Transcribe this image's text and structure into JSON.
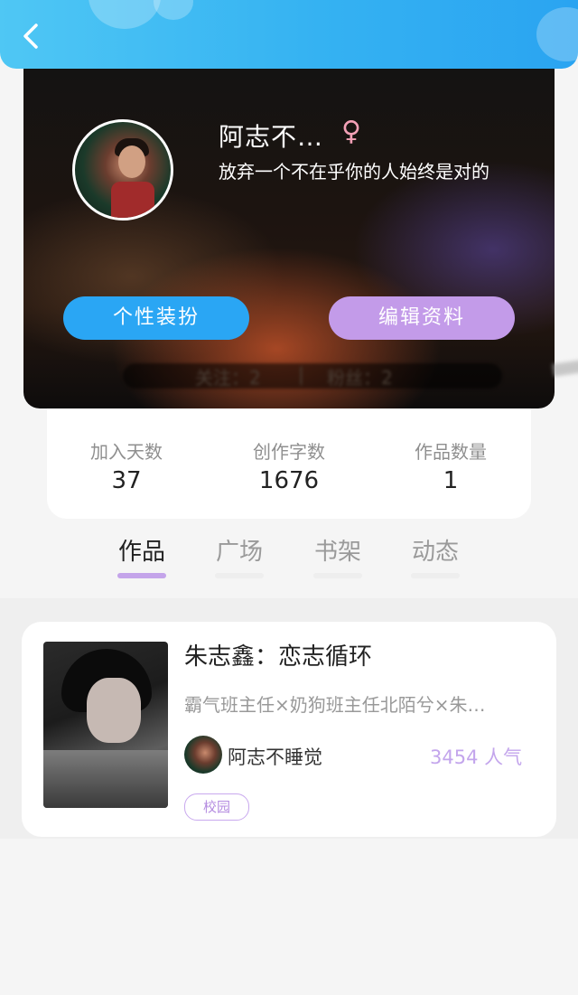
{
  "header": {
    "back_icon": "chevron-left-icon"
  },
  "profile": {
    "name": "阿志不…",
    "gender_icon": "♀",
    "signature": "放弃一个不在乎你的人始终是对的",
    "decorate_button": "个性装扮",
    "edit_button": "编辑资料",
    "following_label": "关注：2",
    "followers_label": "粉丝：2"
  },
  "stats": [
    {
      "label": "加入天数",
      "value": "37"
    },
    {
      "label": "创作字数",
      "value": "1676"
    },
    {
      "label": "作品数量",
      "value": "1"
    }
  ],
  "tabs": [
    {
      "label": "作品",
      "active": true
    },
    {
      "label": "广场",
      "active": false
    },
    {
      "label": "书架",
      "active": false
    },
    {
      "label": "动态",
      "active": false
    }
  ],
  "works": [
    {
      "title": "朱志鑫：恋志循环",
      "description": "霸气班主任×奶狗班主任北陌兮×朱…",
      "author": "阿志不睡觉",
      "popularity": "3454 人气",
      "tag": "校园"
    }
  ],
  "colors": {
    "accent_blue": "#2aa6f4",
    "accent_purple": "#c39be9",
    "tab_active_underline": "#c4a4ea"
  }
}
